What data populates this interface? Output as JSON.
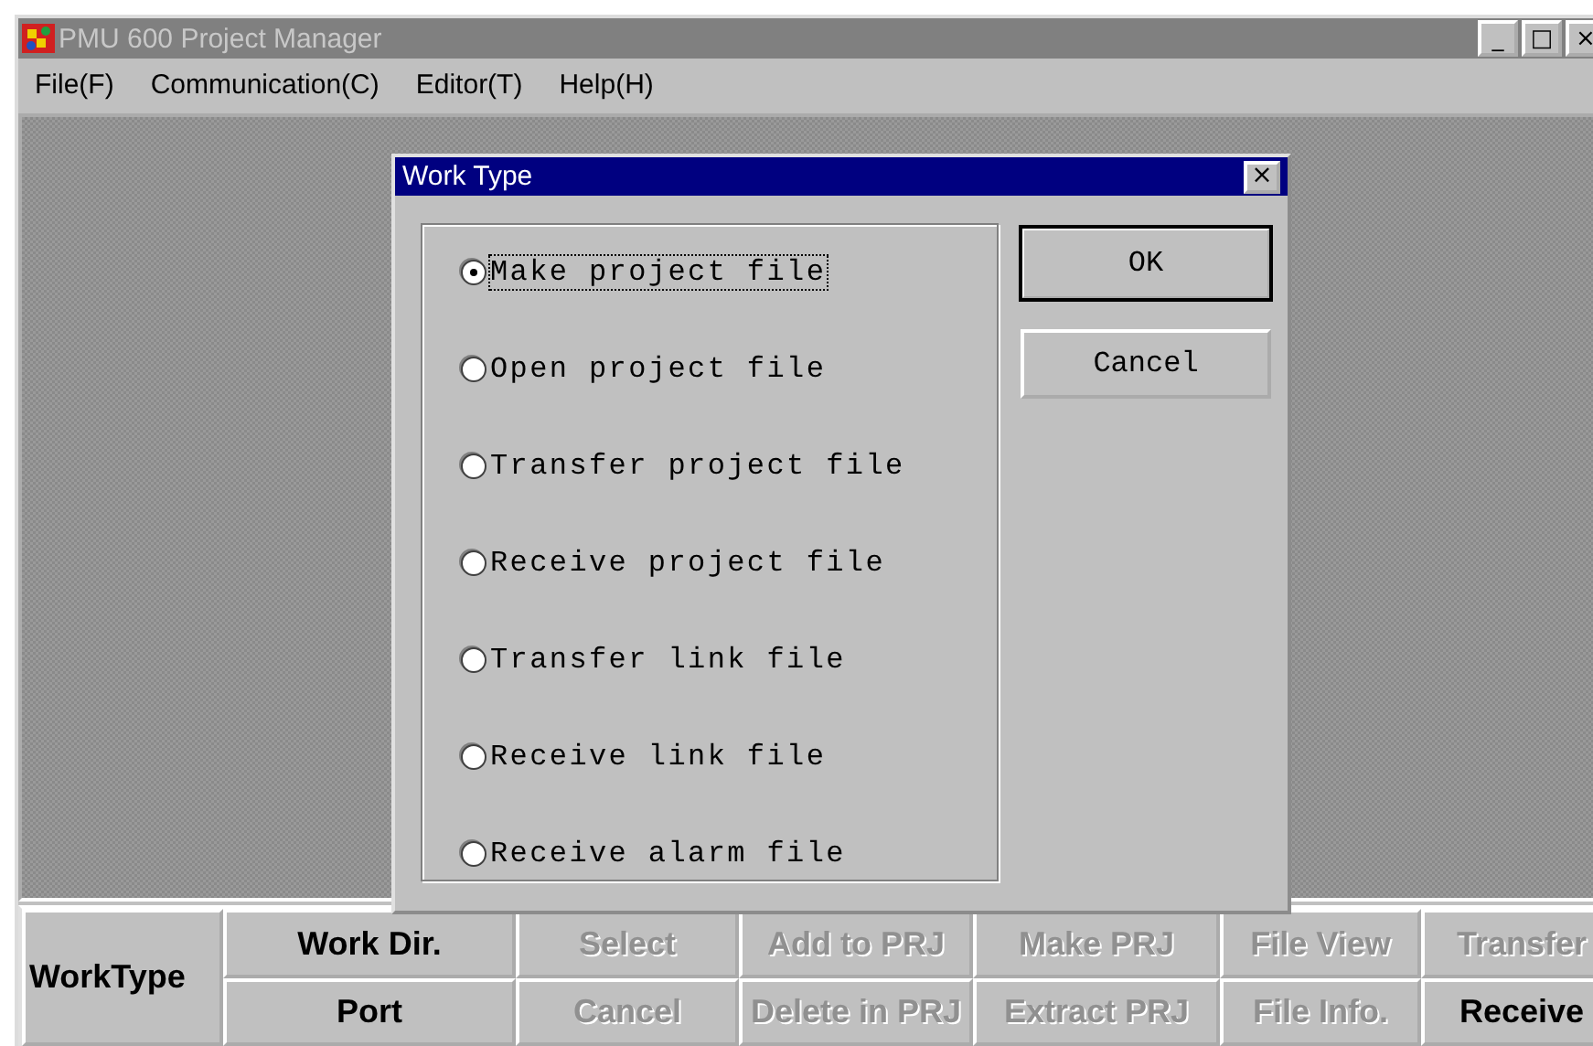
{
  "window": {
    "title": "PMU 600 Project Manager",
    "controls": [
      "_",
      "□",
      "×"
    ]
  },
  "menu": [
    "File(F)",
    "Communication(C)",
    "Editor(T)",
    "Help(H)"
  ],
  "dialog": {
    "title": "Work Type",
    "close": "×",
    "options": [
      {
        "label": "Make project file",
        "selected": true
      },
      {
        "label": "Open project file",
        "selected": false
      },
      {
        "label": "Transfer project file",
        "selected": false
      },
      {
        "label": "Receive project file",
        "selected": false
      },
      {
        "label": "Transfer link file",
        "selected": false
      },
      {
        "label": "Receive link file",
        "selected": false
      },
      {
        "label": "Receive alarm file",
        "selected": false
      }
    ],
    "buttons": [
      {
        "label": "OK",
        "default": true
      },
      {
        "label": "Cancel",
        "default": false
      }
    ]
  },
  "toolbar": {
    "label": "WorkType",
    "rows": [
      [
        {
          "label": "Work Dir.",
          "disabled": false
        },
        {
          "label": "Select",
          "disabled": true
        },
        {
          "label": "Add to PRJ",
          "disabled": true
        },
        {
          "label": "Make PRJ",
          "disabled": true
        },
        {
          "label": "File View",
          "disabled": true
        },
        {
          "label": "Transfer",
          "disabled": true
        }
      ],
      [
        {
          "label": "Port",
          "disabled": false
        },
        {
          "label": "Cancel",
          "disabled": true
        },
        {
          "label": "Delete in PRJ",
          "disabled": true
        },
        {
          "label": "Extract PRJ",
          "disabled": true
        },
        {
          "label": "File Info.",
          "disabled": true
        },
        {
          "label": "Receive",
          "disabled": false
        }
      ]
    ]
  }
}
